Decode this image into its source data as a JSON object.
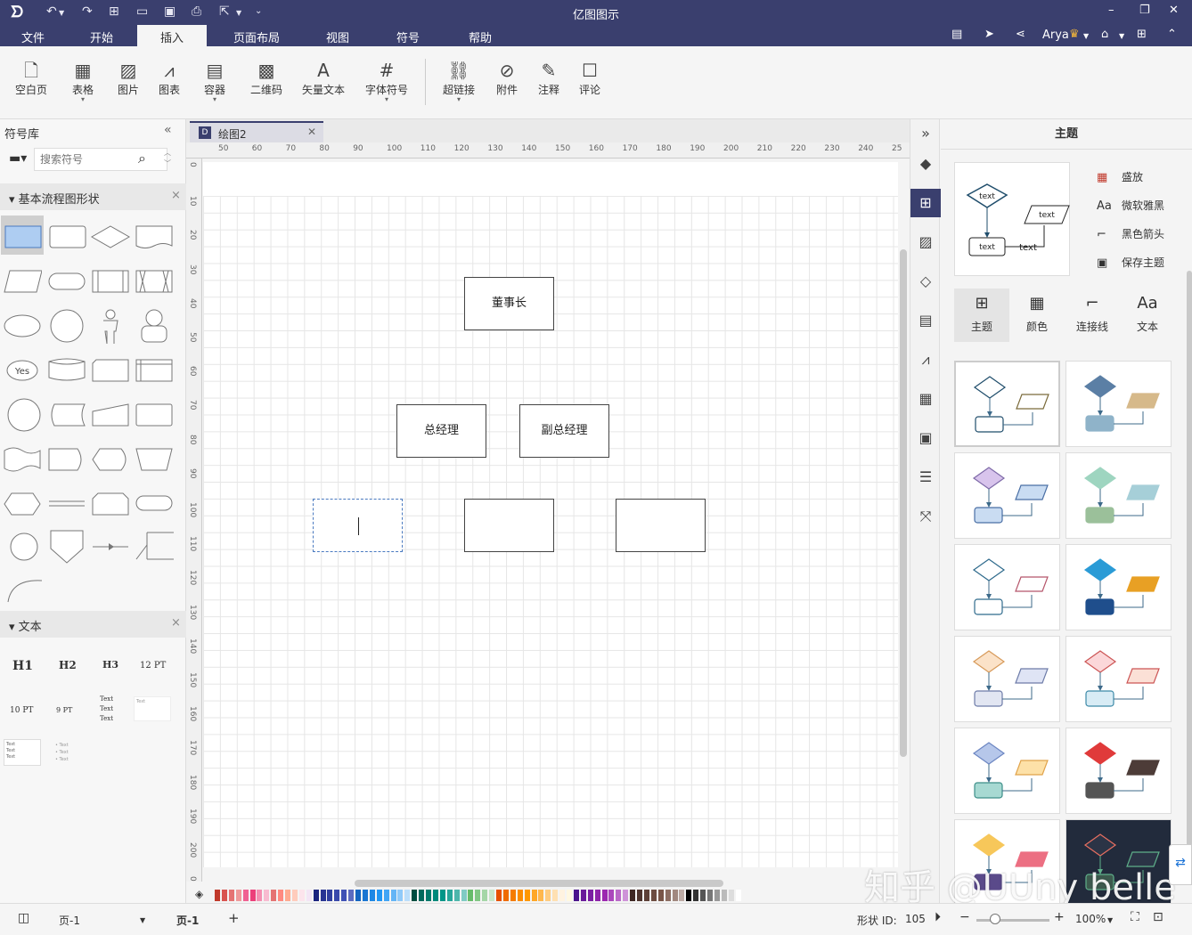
{
  "app": {
    "title": "亿图图示"
  },
  "menu": [
    "文件",
    "开始",
    "插入",
    "页面布局",
    "视图",
    "符号",
    "帮助"
  ],
  "menu_active": "插入",
  "user": {
    "name": "Arya"
  },
  "ribbon": {
    "blank_page": "空白页",
    "table": "表格",
    "image": "图片",
    "chart": "图表",
    "container": "容器",
    "qrcode": "二维码",
    "vector_text": "矢量文本",
    "font_symbol": "字体符号",
    "hyperlink": "超链接",
    "attachment": "附件",
    "note": "注释",
    "comment": "评论"
  },
  "left_panel": {
    "title": "符号库",
    "search_placeholder": "搜索符号",
    "section_flowchart": "基本流程图形状",
    "section_text": "文本",
    "shape_yes_label": "Yes",
    "text_samples": {
      "h1": "H1",
      "h2": "H2",
      "h3": "H3",
      "pt12": "12 PT",
      "pt10": "10 PT",
      "pt9": "9 PT",
      "text": "Text"
    }
  },
  "document": {
    "tab_name": "绘图2"
  },
  "ruler": {
    "horizontal": [
      "50",
      "60",
      "70",
      "80",
      "90",
      "100",
      "110",
      "120",
      "130",
      "140",
      "150",
      "160",
      "170",
      "180",
      "190",
      "200",
      "210",
      "220",
      "230",
      "240",
      "25"
    ],
    "vertical": [
      "0",
      "10",
      "20",
      "30",
      "40",
      "50",
      "60",
      "70",
      "80",
      "90",
      "100",
      "110",
      "120",
      "130",
      "140",
      "150",
      "160",
      "170",
      "180",
      "190",
      "200",
      "0"
    ]
  },
  "diagram": {
    "chairman": "董事长",
    "general_manager": "总经理",
    "deputy_general_manager": "副总经理",
    "empty_node_1": "",
    "empty_node_2": "",
    "empty_node_3": ""
  },
  "theme_panel": {
    "title": "主题",
    "preview_text": "text",
    "options": {
      "bloom": "盛放",
      "font": "微软雅黑",
      "arrow": "黑色箭头",
      "save": "保存主题"
    },
    "tabs": {
      "theme": "主题",
      "color": "颜色",
      "connector": "连接线",
      "text": "文本"
    }
  },
  "status_bar": {
    "page_select": "页-1",
    "page_tab": "页-1",
    "shape_id_label": "形状 ID:",
    "shape_id": "105",
    "zoom": "100%"
  },
  "watermark": "知乎 @UUny belle",
  "colors": {
    "titlebar": "#3a3f6e",
    "accent": "#3a3f6e",
    "selection": "#4a7ac0",
    "shape_fill": "#aecdf2"
  },
  "icons": [
    "undo-icon",
    "redo-icon",
    "new-icon",
    "open-icon",
    "save-icon",
    "print-icon",
    "export-icon",
    "search-icon",
    "gear-icon",
    "share-icon",
    "crown-icon",
    "close-icon",
    "fill-icon",
    "theme-icon",
    "image-icon",
    "layers-icon",
    "page-icon",
    "chart-icon",
    "table-icon",
    "container-icon",
    "format-icon",
    "fit-icon",
    "play-icon",
    "zoom-out-icon",
    "zoom-in-icon",
    "fullscreen-icon"
  ]
}
